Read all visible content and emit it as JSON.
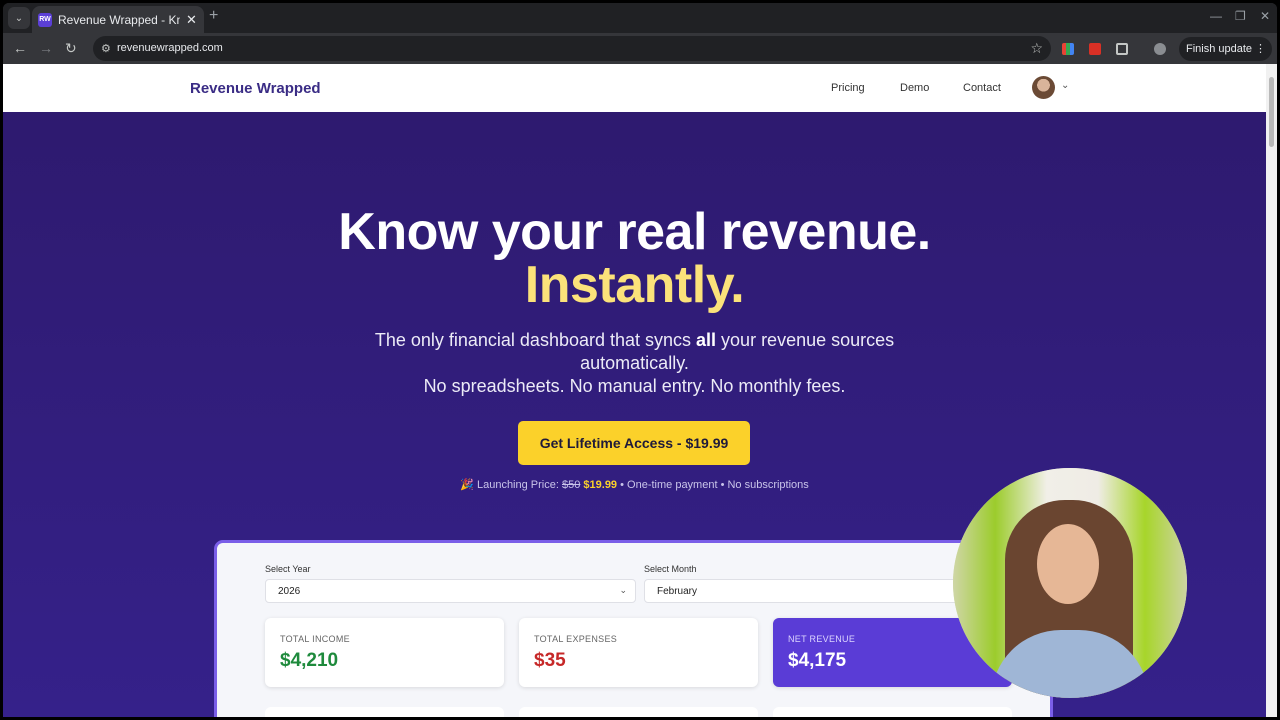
{
  "browser": {
    "tab_title": "Revenue Wrapped - Know",
    "favicon_text": "RW",
    "url": "revenuewrapped.com",
    "finish_update_label": "Finish update"
  },
  "site": {
    "brand": "Revenue Wrapped",
    "nav": [
      "Pricing",
      "Demo",
      "Contact"
    ]
  },
  "hero": {
    "headline": "Know your real revenue.",
    "headline_accent": "Instantly.",
    "sub_line1_pre": "The only financial dashboard that syncs ",
    "sub_line1_bold": "all",
    "sub_line1_post": " your revenue sources",
    "sub_line2": "automatically.",
    "sub_line3": "No spreadsheets. No manual entry. No monthly fees.",
    "cta": "Get Lifetime Access - $19.99",
    "launch_emoji": "🎉",
    "launch_label": "Launching Price:",
    "old_price": "$50",
    "new_price": "$19.99",
    "launch_tail": "• One-time payment • No subscriptions"
  },
  "dashboard": {
    "year_label": "Select Year",
    "year_value": "2026",
    "month_label": "Select Month",
    "month_value": "February",
    "cards": [
      {
        "label": "TOTAL INCOME",
        "value": "$4,210",
        "color": "#1e8a3c"
      },
      {
        "label": "TOTAL EXPENSES",
        "value": "$35",
        "color": "#c62828"
      },
      {
        "label": "NET REVENUE",
        "value": "$4,175",
        "color": "#ffffff"
      }
    ]
  },
  "colors": {
    "hero_bg": "#2e1a6f",
    "accent_yellow": "#fbd12a",
    "accent_purple": "#5a3cd6"
  }
}
